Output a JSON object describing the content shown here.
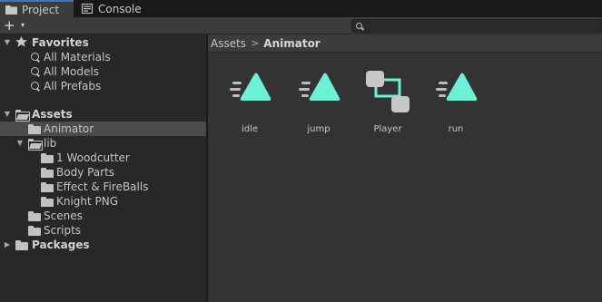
{
  "tabs": [
    {
      "label": "Project",
      "icon": "folder-icon",
      "active": true
    },
    {
      "label": "Console",
      "icon": "console-icon",
      "active": false
    }
  ],
  "toolbar": {
    "add_label": "+",
    "add_caret": "▾",
    "search_placeholder": ""
  },
  "tree": {
    "favorites": {
      "label": "Favorites",
      "items": [
        "All Materials",
        "All Models",
        "All Prefabs"
      ]
    },
    "assets": {
      "label": "Assets",
      "animator": "Animator",
      "lib": {
        "label": "lib",
        "items": [
          "1 Woodcutter",
          "Body Parts",
          "Effect & FireBalls",
          "Knight PNG"
        ]
      },
      "scenes": "Scenes",
      "scripts": "Scripts"
    },
    "packages": "Packages",
    "selected": "Animator"
  },
  "breadcrumb": {
    "root": "Assets",
    "separator": ">",
    "current": "Animator"
  },
  "assets": [
    {
      "name": "idle",
      "icon": "animation-clip-icon"
    },
    {
      "name": "jump",
      "icon": "animation-clip-icon"
    },
    {
      "name": "Player",
      "icon": "animator-controller-icon"
    },
    {
      "name": "run",
      "icon": "animation-clip-icon"
    }
  ],
  "colors": {
    "accent": "#6cf0d6",
    "tab_highlight": "#3a79bb",
    "selection": "#4b4b4b"
  }
}
